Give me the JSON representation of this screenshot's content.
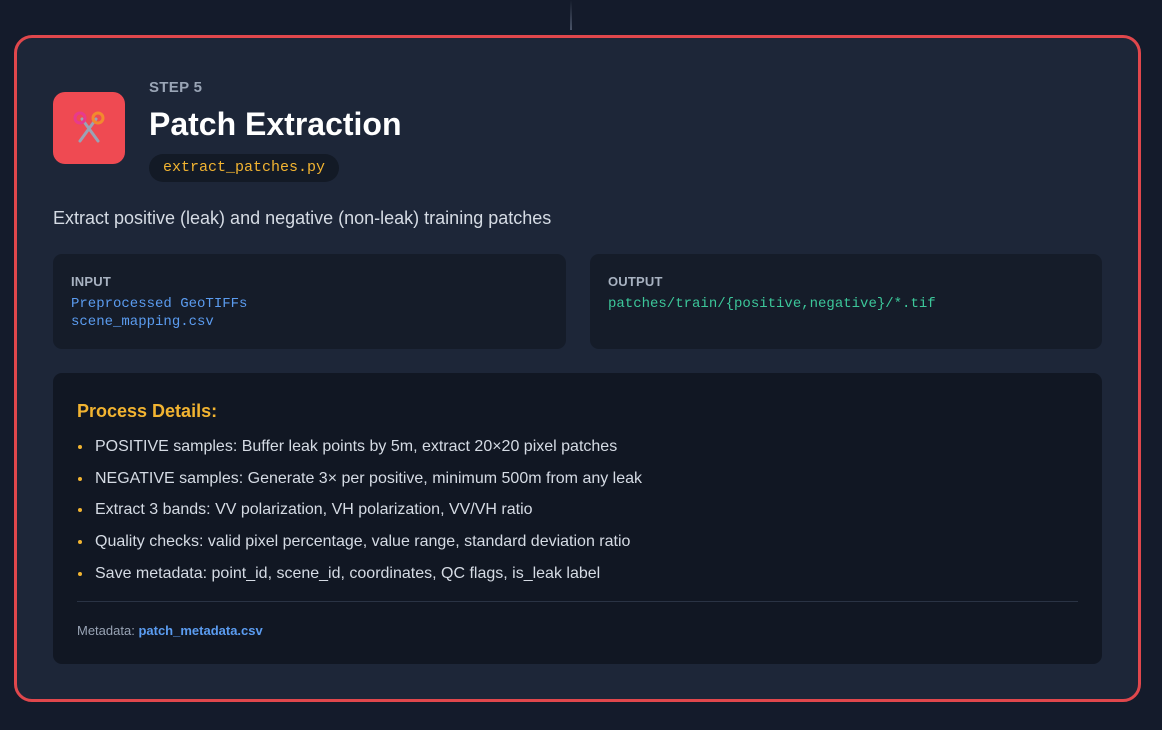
{
  "step": {
    "label": "STEP 5",
    "title": "Patch Extraction",
    "script": "extract_patches.py",
    "icon": "scissors-icon",
    "description": "Extract positive (leak) and negative (non-leak) training patches"
  },
  "input": {
    "heading": "INPUT",
    "lines": [
      "Preprocessed GeoTIFFs",
      "scene_mapping.csv"
    ]
  },
  "output": {
    "heading": "OUTPUT",
    "lines": [
      "patches/train/{positive,negative}/*.tif"
    ]
  },
  "details": {
    "heading": "Process Details:",
    "items": [
      "POSITIVE samples: Buffer leak points by 5m, extract 20×20 pixel patches",
      "NEGATIVE samples: Generate 3× per positive, minimum 500m from any leak",
      "Extract 3 bands: VV polarization, VH polarization, VV/VH ratio",
      "Quality checks: valid pixel percentage, value range, standard deviation ratio",
      "Save metadata: point_id, scene_id, coordinates, QC flags, is_leak label"
    ],
    "metadata_label": "Metadata:",
    "metadata_file": "patch_metadata.csv"
  },
  "colors": {
    "card_border": "#e0474c",
    "accent_yellow": "#f2b431",
    "input_blue": "#5b9cf0",
    "output_green": "#3cc79a",
    "icon_tile": "#ef4a52"
  }
}
